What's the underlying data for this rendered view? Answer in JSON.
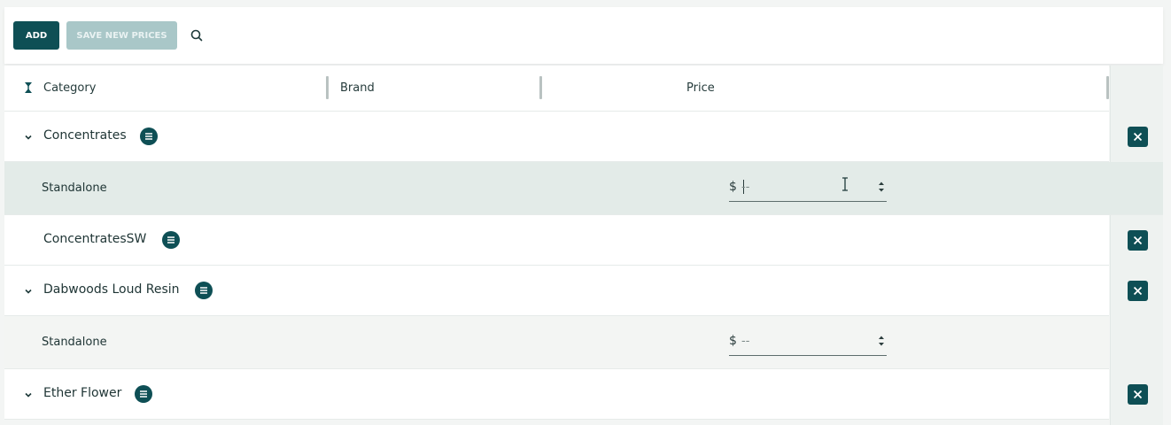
{
  "toolbar": {
    "add_label": "ADD",
    "save_label": "SAVE NEW PRICES",
    "search_icon": "search-icon"
  },
  "table": {
    "columns": {
      "category": "Category",
      "brand": "Brand",
      "price": "Price"
    },
    "rows": [
      {
        "label": "Concentrates",
        "expanded": true
      },
      {
        "label": "Standalone",
        "currency": "$",
        "placeholder": "--"
      },
      {
        "label": "ConcentratesSW",
        "expanded": false
      },
      {
        "label": "Dabwoods Loud Resin",
        "expanded": true
      },
      {
        "label": "Standalone",
        "currency": "$",
        "placeholder": "--"
      },
      {
        "label": "Ether Flower",
        "expanded": true
      }
    ]
  },
  "colors": {
    "primary": "#0e4f55",
    "primary_disabled": "#a9c7c8",
    "active_row": "#e3ebe8",
    "sub_row": "#f3f5f3"
  }
}
